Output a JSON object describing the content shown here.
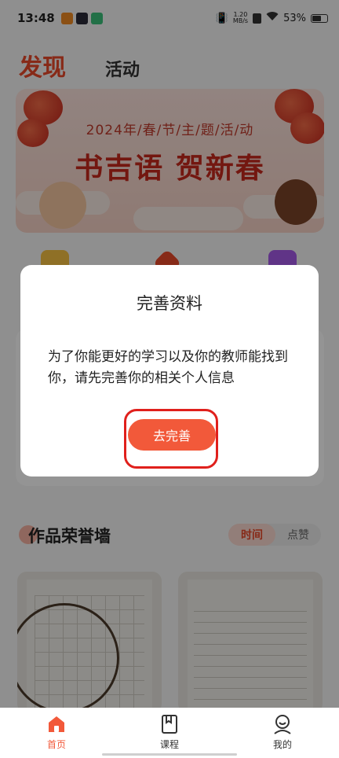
{
  "status_bar": {
    "time": "13:48",
    "net_speed_value": "1.20",
    "net_speed_unit": "MB/s",
    "battery": "53%"
  },
  "header": {
    "tab_discover": "发现",
    "tab_activity": "活动"
  },
  "banner": {
    "subtitle": "2024年/春/节/主/题/活/动",
    "title": "书吉语 贺新春"
  },
  "works": {
    "title": "作品荣誉墙",
    "sort_time": "时间",
    "sort_likes": "点赞"
  },
  "dialog": {
    "title": "完善资料",
    "message": "为了你能更好的学习以及你的教师能找到你，请先完善你的相关个人信息",
    "button": "去完善"
  },
  "bottom_nav": {
    "items": [
      {
        "label": "首页",
        "icon": "home-icon",
        "active": true
      },
      {
        "label": "课程",
        "icon": "book-icon",
        "active": false
      },
      {
        "label": "我的",
        "icon": "profile-icon",
        "active": false
      }
    ]
  },
  "colors": {
    "accent": "#f2593a",
    "brand_red": "#e8492a",
    "highlight": "#e0201c"
  }
}
